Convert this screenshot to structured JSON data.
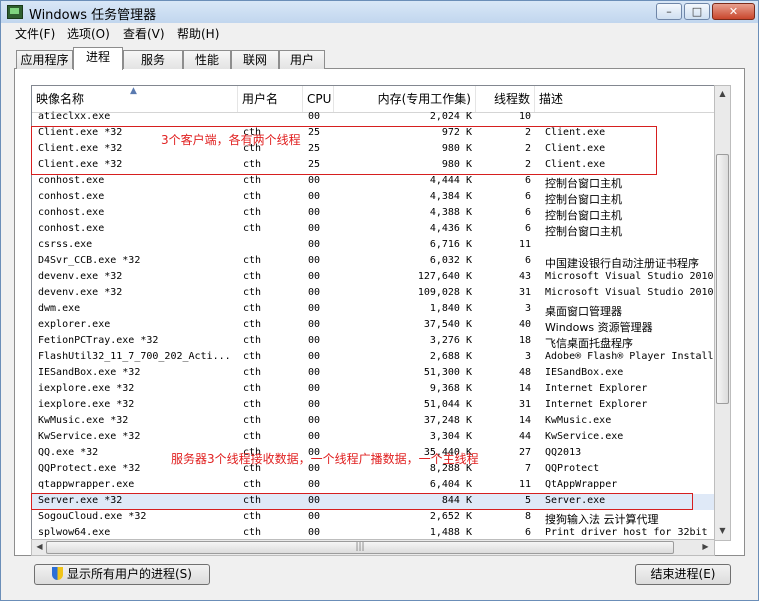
{
  "window": {
    "title": "Windows 任务管理器",
    "min": "–",
    "max": "□",
    "close": "✕"
  },
  "menu": [
    "文件(F)",
    "选项(O)",
    "查看(V)",
    "帮助(H)"
  ],
  "tabs": [
    "应用程序",
    "进程",
    "服务",
    "性能",
    "联网",
    "用户"
  ],
  "active_tab": "进程",
  "columns": [
    "映像名称",
    "用户名",
    "CPU",
    "内存(专用工作集)",
    "线程数",
    "描述"
  ],
  "rows": [
    {
      "name": "atieclxx.exe",
      "user": "",
      "cpu": "00",
      "mem": "2,024 K",
      "threads": "10",
      "desc": ""
    },
    {
      "name": "Client.exe *32",
      "user": "cth",
      "cpu": "25",
      "mem": "972 K",
      "threads": "2",
      "desc": "Client.exe"
    },
    {
      "name": "Client.exe *32",
      "user": "cth",
      "cpu": "25",
      "mem": "980 K",
      "threads": "2",
      "desc": "Client.exe"
    },
    {
      "name": "Client.exe *32",
      "user": "cth",
      "cpu": "25",
      "mem": "980 K",
      "threads": "2",
      "desc": "Client.exe"
    },
    {
      "name": "conhost.exe",
      "user": "cth",
      "cpu": "00",
      "mem": "4,444 K",
      "threads": "6",
      "desc": "控制台窗口主机"
    },
    {
      "name": "conhost.exe",
      "user": "cth",
      "cpu": "00",
      "mem": "4,384 K",
      "threads": "6",
      "desc": "控制台窗口主机"
    },
    {
      "name": "conhost.exe",
      "user": "cth",
      "cpu": "00",
      "mem": "4,388 K",
      "threads": "6",
      "desc": "控制台窗口主机"
    },
    {
      "name": "conhost.exe",
      "user": "cth",
      "cpu": "00",
      "mem": "4,436 K",
      "threads": "6",
      "desc": "控制台窗口主机"
    },
    {
      "name": "csrss.exe",
      "user": "",
      "cpu": "00",
      "mem": "6,716 K",
      "threads": "11",
      "desc": ""
    },
    {
      "name": "D4Svr_CCB.exe *32",
      "user": "cth",
      "cpu": "00",
      "mem": "6,032 K",
      "threads": "6",
      "desc": "中国建设银行自动注册证书程序"
    },
    {
      "name": "devenv.exe *32",
      "user": "cth",
      "cpu": "00",
      "mem": "127,640 K",
      "threads": "43",
      "desc": "Microsoft Visual Studio 2010"
    },
    {
      "name": "devenv.exe *32",
      "user": "cth",
      "cpu": "00",
      "mem": "109,028 K",
      "threads": "31",
      "desc": "Microsoft Visual Studio 2010"
    },
    {
      "name": "dwm.exe",
      "user": "cth",
      "cpu": "00",
      "mem": "1,840 K",
      "threads": "3",
      "desc": "桌面窗口管理器"
    },
    {
      "name": "explorer.exe",
      "user": "cth",
      "cpu": "00",
      "mem": "37,540 K",
      "threads": "40",
      "desc": "Windows 资源管理器"
    },
    {
      "name": "FetionPCTray.exe *32",
      "user": "cth",
      "cpu": "00",
      "mem": "3,276 K",
      "threads": "18",
      "desc": "飞信桌面托盘程序"
    },
    {
      "name": "FlashUtil32_11_7_700_202_Acti...",
      "user": "cth",
      "cpu": "00",
      "mem": "2,688 K",
      "threads": "3",
      "desc": "Adobe® Flash® Player Install"
    },
    {
      "name": "IESandBox.exe *32",
      "user": "cth",
      "cpu": "00",
      "mem": "51,300 K",
      "threads": "48",
      "desc": "IESandBox.exe"
    },
    {
      "name": "iexplore.exe *32",
      "user": "cth",
      "cpu": "00",
      "mem": "9,368 K",
      "threads": "14",
      "desc": "Internet Explorer"
    },
    {
      "name": "iexplore.exe *32",
      "user": "cth",
      "cpu": "00",
      "mem": "51,044 K",
      "threads": "31",
      "desc": "Internet Explorer"
    },
    {
      "name": "KwMusic.exe *32",
      "user": "cth",
      "cpu": "00",
      "mem": "37,248 K",
      "threads": "14",
      "desc": "KwMusic.exe"
    },
    {
      "name": "KwService.exe *32",
      "user": "cth",
      "cpu": "00",
      "mem": "3,304 K",
      "threads": "44",
      "desc": "KwService.exe"
    },
    {
      "name": "QQ.exe *32",
      "user": "cth",
      "cpu": "00",
      "mem": "35,440 K",
      "threads": "27",
      "desc": "QQ2013"
    },
    {
      "name": "QQProtect.exe *32",
      "user": "cth",
      "cpu": "00",
      "mem": "8,288 K",
      "threads": "7",
      "desc": "QQProtect"
    },
    {
      "name": "qtappwrapper.exe",
      "user": "cth",
      "cpu": "00",
      "mem": "6,404 K",
      "threads": "11",
      "desc": "QtAppWrapper"
    },
    {
      "name": "Server.exe *32",
      "user": "cth",
      "cpu": "00",
      "mem": "844 K",
      "threads": "5",
      "desc": "Server.exe"
    },
    {
      "name": "SogouCloud.exe *32",
      "user": "cth",
      "cpu": "00",
      "mem": "2,652 K",
      "threads": "8",
      "desc": "搜狗输入法 云计算代理"
    },
    {
      "name": "splwow64.exe",
      "user": "cth",
      "cpu": "00",
      "mem": "1,488 K",
      "threads": "6",
      "desc": "Print driver host for 32bit"
    }
  ],
  "annotations": {
    "clients": "3个客户端，各有两个线程",
    "server": "服务器3个线程接收数据，一个线程广播数据，一个主线程"
  },
  "buttons": {
    "show_all": "显示所有用户的进程(S)",
    "end_process": "结束进程(E)"
  },
  "colors": {
    "annotation": "#e02020",
    "selection": "#dfe9f7"
  }
}
